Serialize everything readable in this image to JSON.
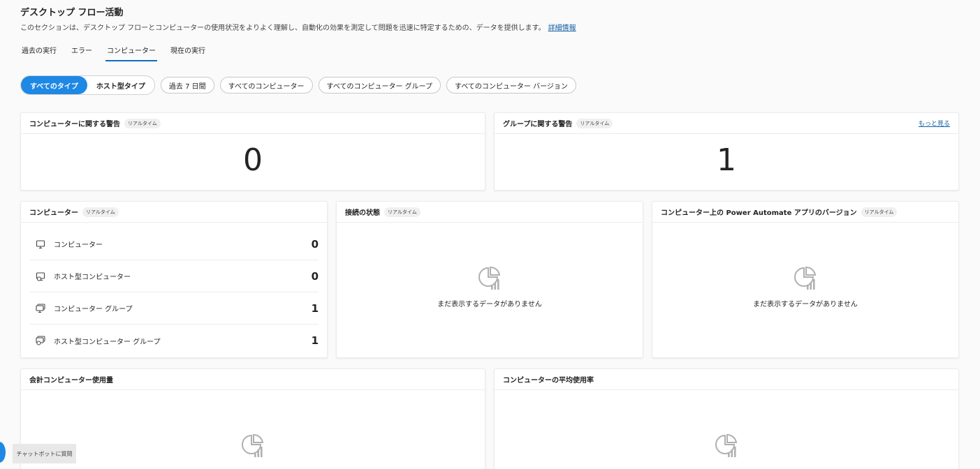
{
  "header": {
    "title": "デスクトップ フロー活動",
    "description": "このセクションは、デスクトップ フローとコンピューターの使用状況をよりよく理解し、自動化の効果を測定して問題を迅速に特定するための、データを提供します。",
    "learn_more": "詳細情報"
  },
  "tabs": [
    {
      "label": "過去の実行"
    },
    {
      "label": "エラー"
    },
    {
      "label": "コンピューター"
    },
    {
      "label": "現在の実行"
    }
  ],
  "filters": {
    "type_all": "すべてのタイプ",
    "type_hosted": "ホスト型タイプ",
    "period": "過去 7 日間",
    "computers": "すべてのコンピューター",
    "groups": "すべてのコンピューター グループ",
    "versions": "すべてのコンピューター バージョン"
  },
  "realtime_badge": "リアルタイム",
  "cards": {
    "computer_alerts": {
      "title": "コンピューターに関する警告",
      "value": "0"
    },
    "group_alerts": {
      "title": "グループに関する警告",
      "value": "1",
      "more": "もっと見る"
    },
    "computers": {
      "title": "コンピューター",
      "rows": [
        {
          "label": "コンピューター",
          "value": "0",
          "icon": "monitor-icon"
        },
        {
          "label": "ホスト型コンピューター",
          "value": "0",
          "icon": "hosted-monitor-icon"
        },
        {
          "label": "コンピューター グループ",
          "value": "1",
          "icon": "monitor-group-icon"
        },
        {
          "label": "ホスト型コンピューター グループ",
          "value": "1",
          "icon": "hosted-group-icon"
        }
      ]
    },
    "connection": {
      "title": "接続の状態",
      "empty": "まだ表示するデータがありません"
    },
    "app_version": {
      "title": "コンピューター上の Power Automate アプリのバージョン",
      "empty": "まだ表示するデータがありません"
    },
    "total_usage": {
      "title": "会計コンピューター使用量"
    },
    "avg_usage": {
      "title": "コンピューターの平均使用率"
    }
  },
  "chat_button": "チャットボットに質問",
  "colors": {
    "accent": "#1e88e5",
    "link": "#115ea3",
    "tab_underline": "#0f6cbd"
  }
}
